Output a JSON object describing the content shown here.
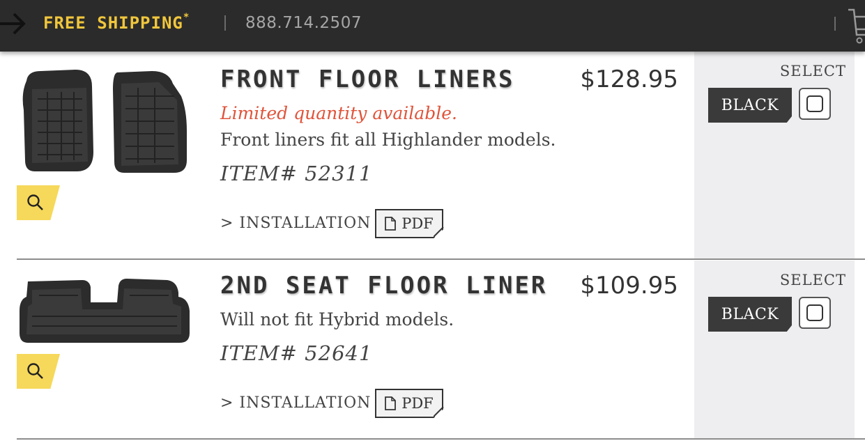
{
  "header": {
    "promo": "FREE SHIPPING",
    "promo_mark": "*",
    "divider": "|",
    "phone": "888.714.2507",
    "colors": {
      "bar": "#2b2b2b",
      "promo": "#f0c63c",
      "phone": "#a6a6a6"
    },
    "icons": [
      "arrow-right-icon",
      "cart-icon"
    ]
  },
  "products": [
    {
      "title": "FRONT FLOOR LINERS",
      "price": "$128.95",
      "notice": "Limited quantity available.",
      "description": "Front liners fit all Highlander models.",
      "item": "ITEM# 52311",
      "install_link": "> INSTALLATION",
      "pdf_label": "PDF",
      "select_label": "SELECT",
      "color_option": "BLACK",
      "selected": false
    },
    {
      "title": "2ND SEAT FLOOR LINER",
      "price": "$109.95",
      "description": "Will not fit Hybrid models.",
      "item": "ITEM# 52641",
      "install_link": "> INSTALLATION",
      "pdf_label": "PDF",
      "select_label": "SELECT",
      "color_option": "BLACK",
      "selected": false
    }
  ],
  "colors": {
    "notice": "#e0533a",
    "zoom_button": "#f6d85a",
    "select_panel": "#eeeef0",
    "color_button": "#3a3a3a"
  }
}
